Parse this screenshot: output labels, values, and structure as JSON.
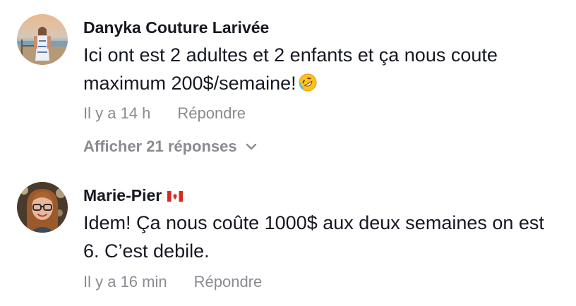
{
  "comments": [
    {
      "username": "Danyka Couture Larivée",
      "text": "Ici ont est 2 adultes et 2 enfants et ça nous coute maximum 200$/semaine!",
      "emoji": "rolling-on-floor-laughing-emoji",
      "time": "Il y a 14 h",
      "reply_label": "Répondre",
      "view_replies": "Afficher 21 réponses"
    },
    {
      "username": "Marie-Pier",
      "flag": "canada-flag-icon",
      "text": "Idem! Ça nous coûte 1000$ aux deux semaines on est 6. C’est debile.",
      "time": "Il y a 16 min",
      "reply_label": "Répondre"
    }
  ],
  "colors": {
    "primary_text": "#161823",
    "secondary_text": "#8a8b91",
    "flag_red": "#d52b1e"
  }
}
